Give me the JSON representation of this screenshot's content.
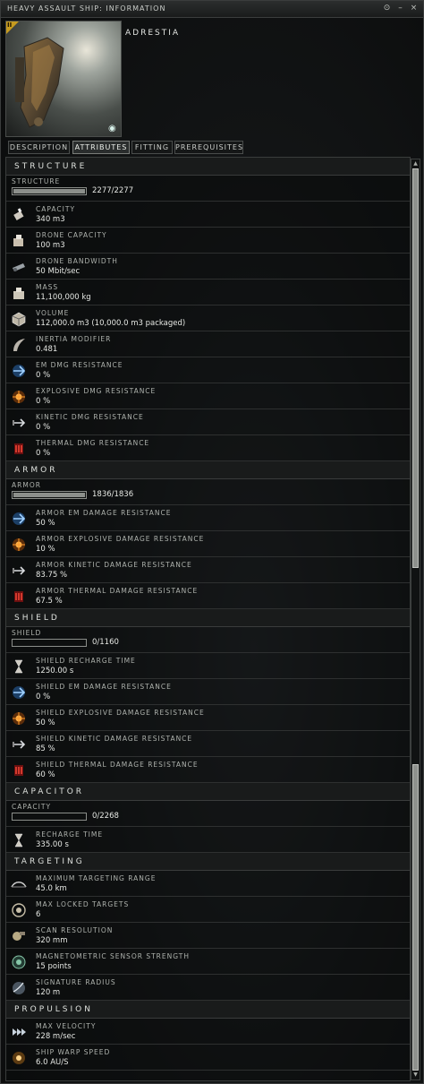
{
  "window": {
    "title": "HEAVY ASSAULT SHIP: INFORMATION"
  },
  "ship": {
    "name": "ADRESTIA",
    "corner_mark": "II"
  },
  "tabs": [
    {
      "label": "DESCRIPTION",
      "active": false
    },
    {
      "label": "ATTRIBUTES",
      "active": true
    },
    {
      "label": "FITTING",
      "active": false
    },
    {
      "label": "PREREQUISITES",
      "active": false
    }
  ],
  "sections": [
    {
      "title": "STRUCTURE",
      "bar": {
        "label": "STRUCTURE",
        "value": "2277/2277",
        "fraction": 1.0
      },
      "rows": [
        {
          "label": "CAPACITY",
          "value": "340 m3",
          "icon": "capacity-icon"
        },
        {
          "label": "DRONE CAPACITY",
          "value": "100 m3",
          "icon": "drone-capacity-icon"
        },
        {
          "label": "DRONE BANDWIDTH",
          "value": "50 Mbit/sec",
          "icon": "drone-bandwidth-icon"
        },
        {
          "label": "MASS",
          "value": "11,100,000 kg",
          "icon": "mass-icon"
        },
        {
          "label": "VOLUME",
          "value": "112,000.0 m3 (10,000.0 m3 packaged)",
          "icon": "volume-icon"
        },
        {
          "label": "INERTIA MODIFIER",
          "value": "0.481",
          "icon": "inertia-icon"
        },
        {
          "label": "EM DMG RESISTANCE",
          "value": "0 %",
          "icon": "em-resistance-icon"
        },
        {
          "label": "EXPLOSIVE DMG RESISTANCE",
          "value": "0 %",
          "icon": "explosive-resistance-icon"
        },
        {
          "label": "KINETIC DMG RESISTANCE",
          "value": "0 %",
          "icon": "kinetic-resistance-icon"
        },
        {
          "label": "THERMAL DMG RESISTANCE",
          "value": "0 %",
          "icon": "thermal-resistance-icon"
        }
      ]
    },
    {
      "title": "ARMOR",
      "bar": {
        "label": "ARMOR",
        "value": "1836/1836",
        "fraction": 1.0
      },
      "rows": [
        {
          "label": "ARMOR EM DAMAGE RESISTANCE",
          "value": "50 %",
          "icon": "em-resistance-icon"
        },
        {
          "label": "ARMOR EXPLOSIVE DAMAGE RESISTANCE",
          "value": "10 %",
          "icon": "explosive-resistance-icon"
        },
        {
          "label": "ARMOR KINETIC DAMAGE RESISTANCE",
          "value": "83.75 %",
          "icon": "kinetic-resistance-icon"
        },
        {
          "label": "ARMOR THERMAL DAMAGE RESISTANCE",
          "value": "67.5 %",
          "icon": "thermal-resistance-icon"
        }
      ]
    },
    {
      "title": "SHIELD",
      "bar": {
        "label": "SHIELD",
        "value": "0/1160",
        "fraction": 0.0
      },
      "rows": [
        {
          "label": "SHIELD RECHARGE TIME",
          "value": "1250.00 s",
          "icon": "hourglass-icon"
        },
        {
          "label": "SHIELD EM DAMAGE RESISTANCE",
          "value": "0 %",
          "icon": "em-resistance-icon"
        },
        {
          "label": "SHIELD EXPLOSIVE DAMAGE RESISTANCE",
          "value": "50 %",
          "icon": "explosive-resistance-icon"
        },
        {
          "label": "SHIELD KINETIC DAMAGE RESISTANCE",
          "value": "85 %",
          "icon": "kinetic-resistance-icon"
        },
        {
          "label": "SHIELD THERMAL DAMAGE RESISTANCE",
          "value": "60 %",
          "icon": "thermal-resistance-icon"
        }
      ]
    },
    {
      "title": "CAPACITOR",
      "bar": {
        "label": "CAPACITY",
        "value": "0/2268",
        "fraction": 0.0
      },
      "rows": [
        {
          "label": "RECHARGE TIME",
          "value": "335.00 s",
          "icon": "hourglass-icon"
        }
      ]
    },
    {
      "title": "TARGETING",
      "bar": null,
      "rows": [
        {
          "label": "MAXIMUM TARGETING RANGE",
          "value": "45.0 km",
          "icon": "targeting-range-icon"
        },
        {
          "label": "MAX LOCKED TARGETS",
          "value": "6",
          "icon": "locked-targets-icon"
        },
        {
          "label": "SCAN RESOLUTION",
          "value": "320 mm",
          "icon": "scan-resolution-icon"
        },
        {
          "label": "MAGNETOMETRIC SENSOR STRENGTH",
          "value": "15 points",
          "icon": "sensor-strength-icon"
        },
        {
          "label": "SIGNATURE RADIUS",
          "value": "120 m",
          "icon": "signature-radius-icon"
        }
      ]
    },
    {
      "title": "PROPULSION",
      "bar": null,
      "rows": [
        {
          "label": "MAX VELOCITY",
          "value": "228 m/sec",
          "icon": "velocity-icon"
        },
        {
          "label": "SHIP WARP SPEED",
          "value": "6.0 AU/S",
          "icon": "warp-speed-icon"
        }
      ]
    }
  ]
}
